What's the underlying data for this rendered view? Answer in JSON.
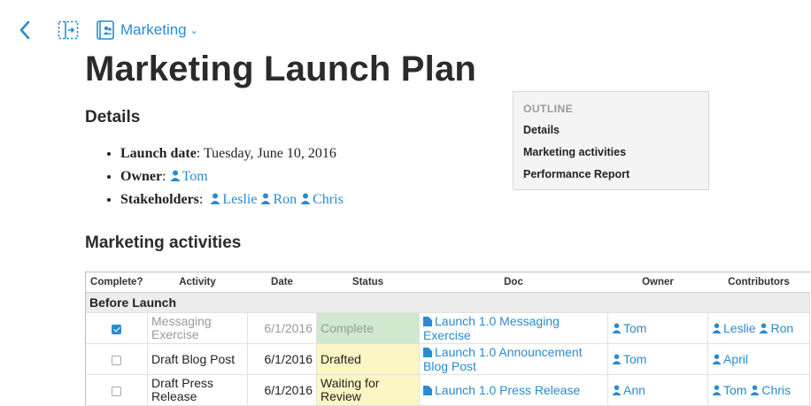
{
  "nav": {
    "folder_label": "Marketing"
  },
  "page_title": "Marketing Launch Plan",
  "details": {
    "heading": "Details",
    "launch_label": "Launch date",
    "launch_value": "Tuesday, June 10, 2016",
    "owner_label": "Owner",
    "owner": "Tom",
    "stakeholders_label": "Stakeholders",
    "stakeholders": [
      "Leslie",
      "Ron",
      "Chris"
    ]
  },
  "outline": {
    "heading": "OUTLINE",
    "items": [
      "Details",
      "Marketing activities",
      "Performance Report"
    ]
  },
  "activities": {
    "heading": "Marketing activities",
    "columns": [
      "Complete?",
      "Activity",
      "Date",
      "Status",
      "Doc",
      "Owner",
      "Contributors"
    ],
    "group": "Before Launch",
    "rows": [
      {
        "complete": true,
        "activity": "Messaging Exercise",
        "date": "6/1/2016",
        "status": "Complete",
        "doc": "Launch 1.0 Messaging Exercise",
        "owner": "Tom",
        "contributors": [
          "Leslie",
          "Ron"
        ]
      },
      {
        "complete": false,
        "activity": "Draft Blog Post",
        "date": "6/1/2016",
        "status": "Drafted",
        "doc": "Launch 1.0 Announcement Blog Post",
        "owner": "Tom",
        "contributors": [
          "April"
        ]
      },
      {
        "complete": false,
        "activity": "Draft Press Release",
        "date": "6/1/2016",
        "status": "Waiting for Review",
        "doc": "Launch 1.0 Press Release",
        "owner": "Ann",
        "contributors": [
          "Tom",
          "Chris"
        ]
      }
    ]
  },
  "colors": {
    "accent": "#2a8bd0",
    "complete_bg": "#cfe8cf",
    "pending_bg": "#fbf6c3"
  }
}
